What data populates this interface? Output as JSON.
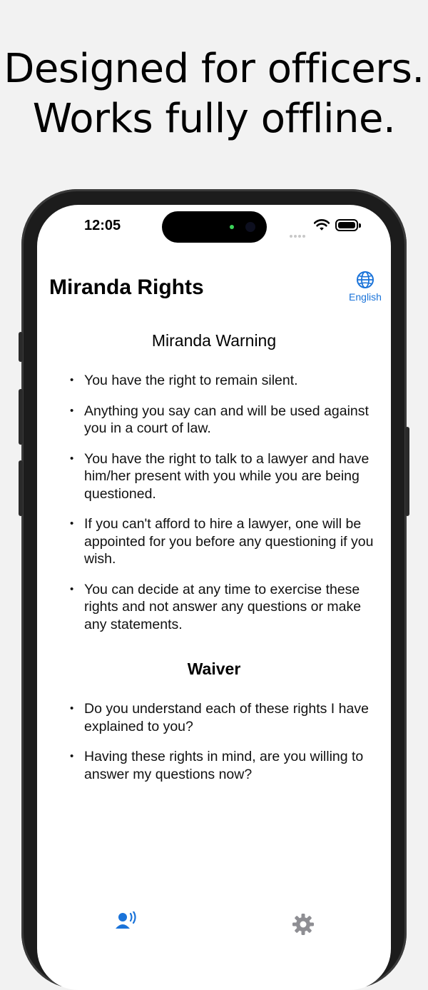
{
  "headline": {
    "line1": "Designed for officers.",
    "line2": "Works fully offline."
  },
  "status_bar": {
    "time": "12:05"
  },
  "nav": {
    "title": "Miranda Rights",
    "language_label": "English"
  },
  "miranda": {
    "title": "Miranda Warning",
    "items": [
      "You have the right to remain silent.",
      "Anything you say can and will be used against you in a court of law.",
      "You have the right to talk to a lawyer and have him/her present with you while you are being questioned.",
      "If you can't afford to hire a lawyer, one will be appointed for you before any questioning if you wish.",
      "You can decide at any time to exercise these rights and not answer any questions or make any statements."
    ]
  },
  "waiver": {
    "title": "Waiver",
    "items": [
      "Do you understand each of these rights I have explained to you?",
      "Having these rights in mind, are you willing to answer my questions now?"
    ]
  },
  "tabbar": {
    "icons": [
      "speaking-person-icon",
      "gear-icon"
    ]
  },
  "colors": {
    "accent": "#1a73d9",
    "background": "#f2f2f2"
  }
}
